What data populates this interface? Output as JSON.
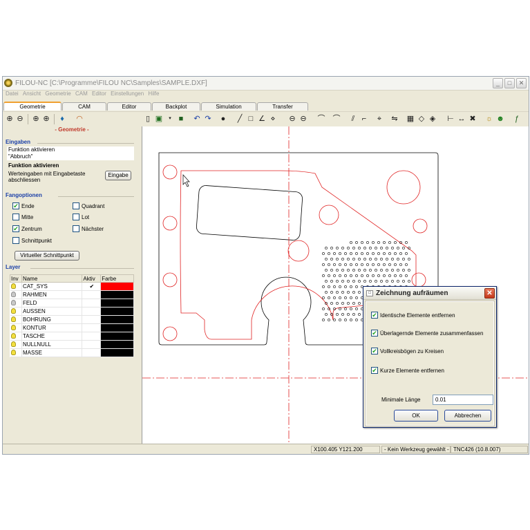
{
  "window": {
    "title": "FILOU-NC  [C:\\Programme\\FILOU NC\\Samples\\SAMPLE.DXF]",
    "minimize": "_",
    "maximize": "□",
    "close": "✕"
  },
  "menu": [
    "Datei",
    "Ansicht",
    "Geometrie",
    "CAM",
    "Editor",
    "Einstellungen",
    "Hilfe"
  ],
  "tabs": [
    "Geometrie",
    "CAM",
    "Editor",
    "Backplot",
    "Simulation",
    "Transfer"
  ],
  "left_panel": {
    "title": "- Geometrie -",
    "eingaben": {
      "header": "Eingaben",
      "line1": "Funktion aktivieren",
      "line2": "\"Abbruch\"",
      "bold_line": "Funktion aktivieren",
      "hint": "Werteingaben mit Eingabetaste abschliessen",
      "button": "Eingabe"
    },
    "fangoptionen": {
      "header": "Fangoptionen",
      "ende": "Ende",
      "quadrant": "Quadrant",
      "mitte": "Mitte",
      "lot": "Lot",
      "zentrum": "Zentrum",
      "naechster": "Nächster",
      "schnittpunkt": "Schnittpunkt",
      "virtual_button": "Virtueller Schnittpunkt"
    },
    "layer": {
      "header": "Layer",
      "columns": [
        "Inv",
        "Name",
        "Aktiv",
        "Farbe"
      ],
      "rows": [
        {
          "name": "CAT_SYS",
          "aktiv": "✔",
          "color": "#ff0000",
          "visible": true
        },
        {
          "name": "RAHMEN",
          "aktiv": "",
          "color": "#000000",
          "visible": false
        },
        {
          "name": "FELD",
          "aktiv": "",
          "color": "#000000",
          "visible": false
        },
        {
          "name": "AUSSEN",
          "aktiv": "",
          "color": "#000000",
          "visible": true
        },
        {
          "name": "BOHRUNG",
          "aktiv": "",
          "color": "#000000",
          "visible": true
        },
        {
          "name": "KONTUR",
          "aktiv": "",
          "color": "#000000",
          "visible": true
        },
        {
          "name": "TASCHE",
          "aktiv": "",
          "color": "#000000",
          "visible": true
        },
        {
          "name": "NULLNULL",
          "aktiv": "",
          "color": "#000000",
          "visible": true
        },
        {
          "name": "MASSE",
          "aktiv": "",
          "color": "#000000",
          "visible": true
        }
      ]
    }
  },
  "status": {
    "coords": "X100.405 Y121.200",
    "tool": "- Kein Werkzeug gewählt -",
    "control": "TNC426  (10.8.007)"
  },
  "dialog": {
    "title": "Zeichnung aufräumen",
    "opt1": "Identische Elemente entfernen",
    "opt2": "Überlagernde Elemente zusammenfassen",
    "opt3": "Vollkreisbögen zu Kreisen",
    "opt4": "Kurze Elemente entfernen",
    "min_label": "Minimale Länge",
    "min_value": "0.01",
    "ok": "OK",
    "cancel": "Abbrechen"
  },
  "colors": {
    "geometry_red": "#e02020",
    "outline_black": "#000000",
    "axis_red": "#e02020",
    "accent_blue": "#1a3fa8"
  }
}
